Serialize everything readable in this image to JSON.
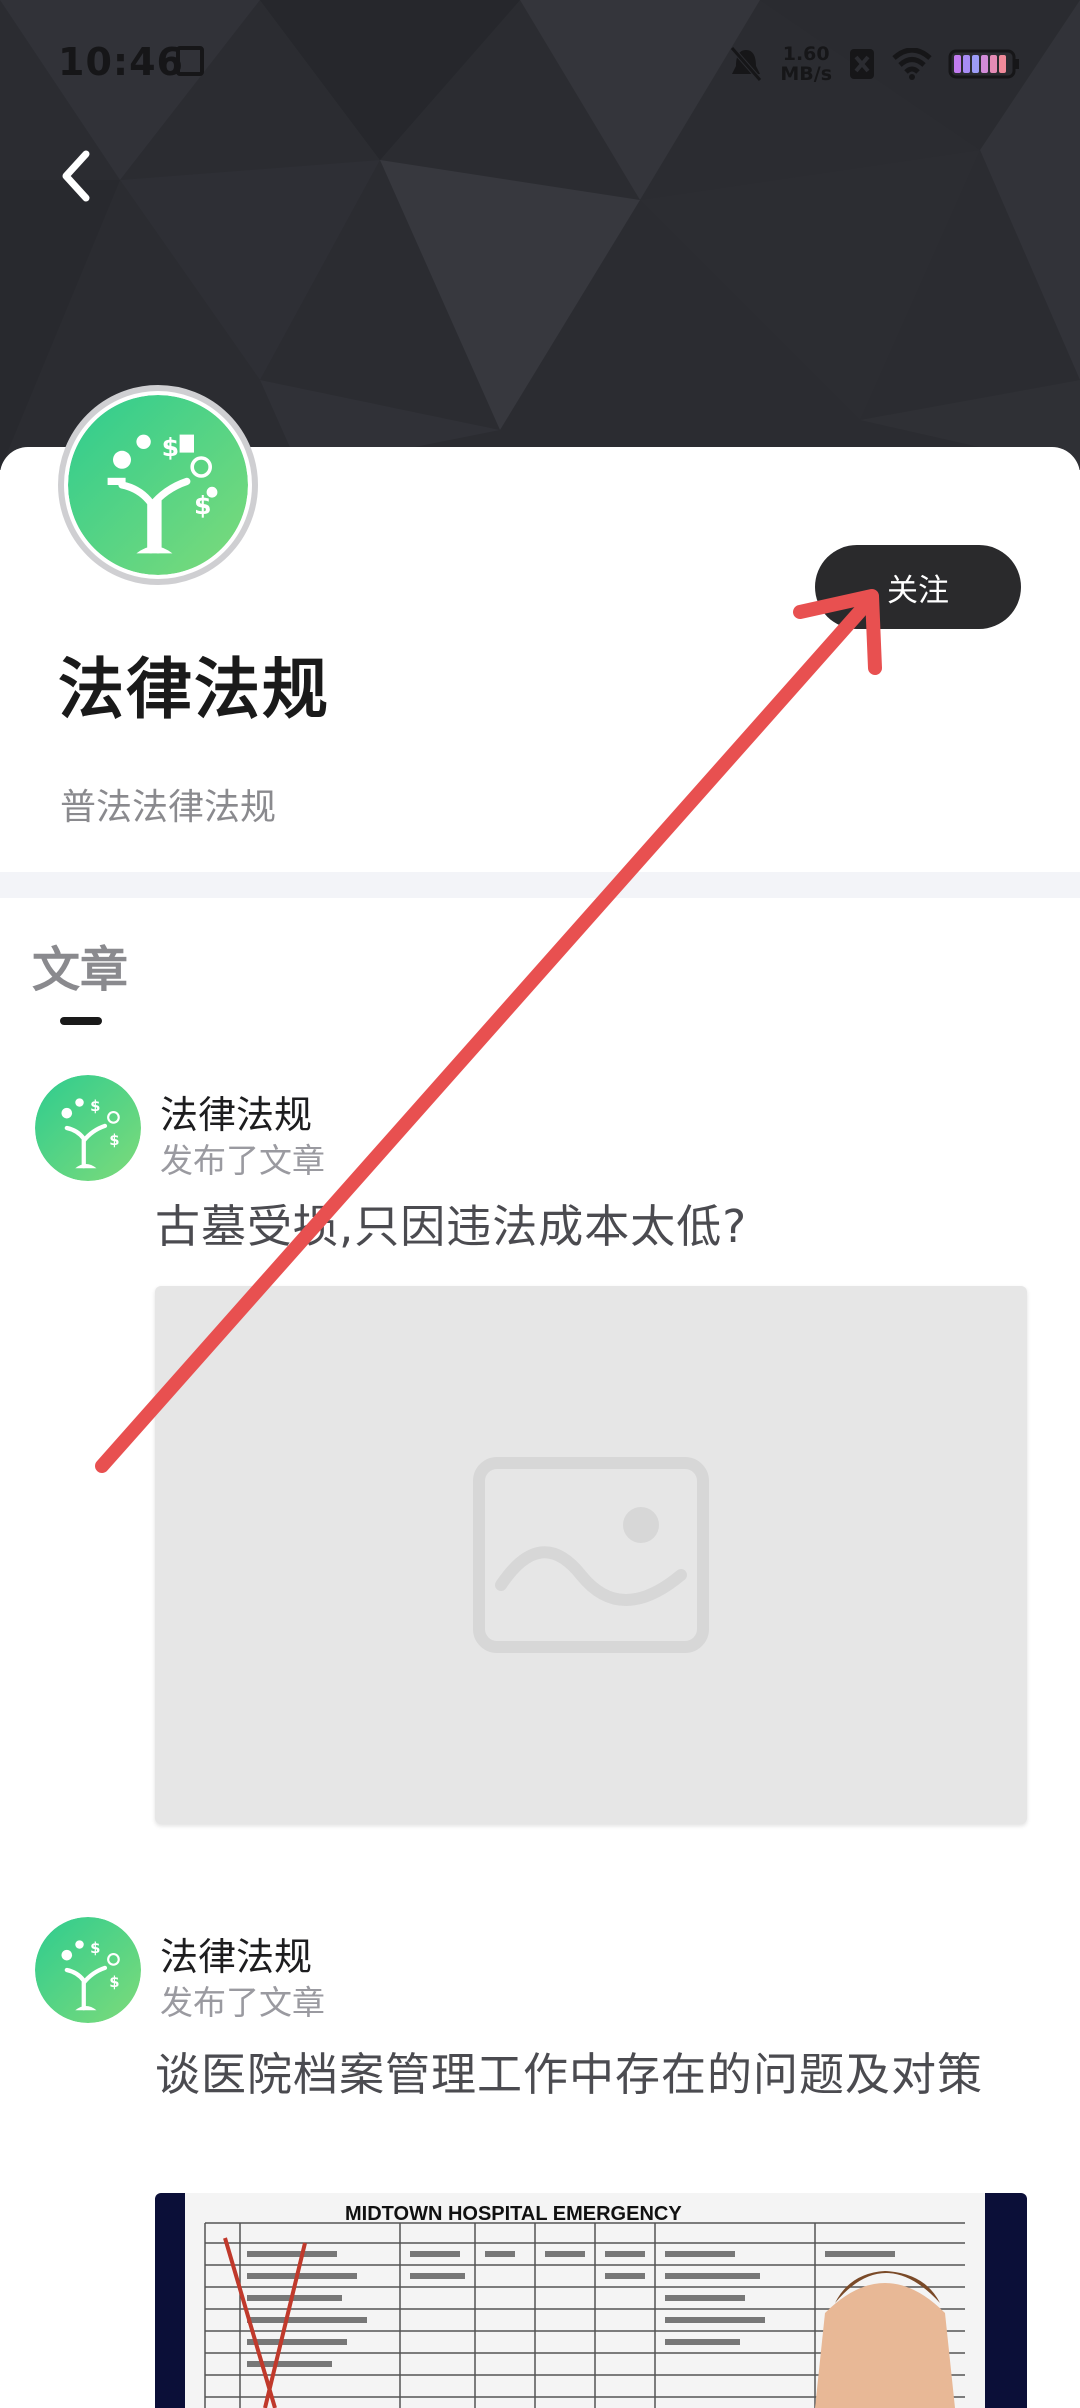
{
  "status_bar": {
    "time": "10:46",
    "net_speed_value": "1.60",
    "net_speed_unit": "MB/s"
  },
  "header": {
    "back_icon": "chevron-left-icon"
  },
  "profile": {
    "title": "法律法规",
    "subtitle": "普法法律法规",
    "follow_label": "关注"
  },
  "tabs": {
    "articles_label": "文章"
  },
  "feed": [
    {
      "author": "法律法规",
      "action": "发布了文章",
      "title": "古墓受损,只因违法成本太低?"
    },
    {
      "author": "法律法规",
      "action": "发布了文章",
      "title": "谈医院档案管理工作中存在的问题及对策",
      "image_heading": "MIDTOWN HOSPITAL EMERGENCY"
    }
  ],
  "colors": {
    "banner": "#2b2c31",
    "follow_button": "#2a2a2c",
    "logo_gradient_start": "#2ecc8f",
    "logo_gradient_end": "#7edb7a",
    "annotation": "#e85050"
  }
}
